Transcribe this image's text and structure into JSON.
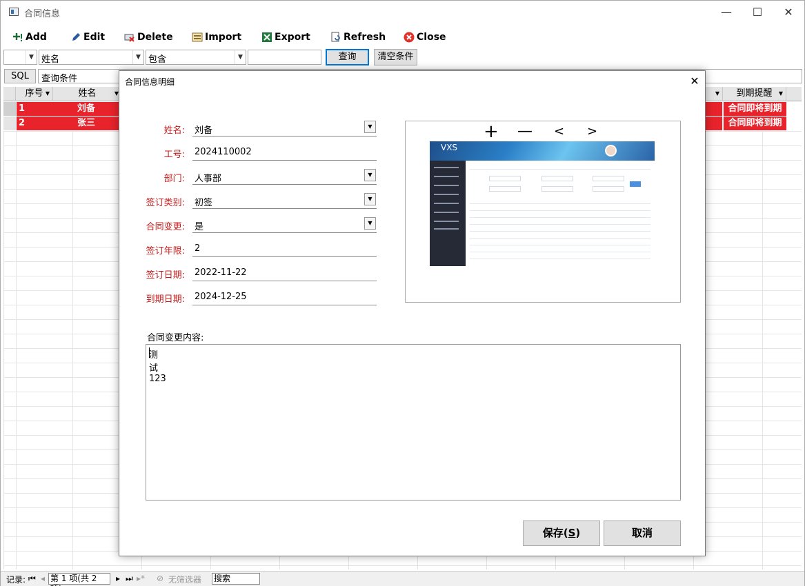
{
  "window": {
    "title": "合同信息",
    "controls": {
      "minimize": "—",
      "maximize": "☐",
      "close": "✕"
    }
  },
  "toolbar": {
    "add": "Add",
    "edit": "Edit",
    "delete": "Delete",
    "import": "Import",
    "export": "Export",
    "refresh": "Refresh",
    "close": "Close"
  },
  "filter": {
    "field1": "",
    "field2": "姓名",
    "operator": "包含",
    "value": "",
    "query_button": "查询",
    "clear_button": "清空条件"
  },
  "sql": {
    "label": "SQL",
    "text": "查询条件"
  },
  "grid": {
    "columns": [
      "序号",
      "姓名",
      "到期提醒"
    ],
    "rows": [
      {
        "index": "1",
        "name": "刘备",
        "reminder": "合同即将到期"
      },
      {
        "index": "2",
        "name": "张三",
        "reminder": "合同即将到期"
      }
    ]
  },
  "statusbar": {
    "records_label": "记录:",
    "page_text": "第 1 项(共 2 项)",
    "filter_label": "无筛选器",
    "search_text": "搜索"
  },
  "dialog": {
    "title": "合同信息明细",
    "close": "✕",
    "fields": [
      {
        "label": "姓名:",
        "value": "刘备",
        "dropdown": true
      },
      {
        "label": "工号:",
        "value": "2024110002",
        "dropdown": false
      },
      {
        "label": "部门:",
        "value": "人事部",
        "dropdown": true
      },
      {
        "label": "签订类别:",
        "value": "初签",
        "dropdown": true
      },
      {
        "label": "合同变更:",
        "value": "是",
        "dropdown": true
      },
      {
        "label": "签订年限:",
        "value": "2",
        "dropdown": false
      },
      {
        "label": "签订日期:",
        "value": "2022-11-22",
        "dropdown": false
      },
      {
        "label": "到期日期:",
        "value": "2024-12-25",
        "dropdown": false
      }
    ],
    "image_controls": {
      "zoom_in": "+",
      "zoom_out": "—",
      "prev": "<",
      "next": ">"
    },
    "preview_logo": "VXS",
    "content_label": "合同变更内容:",
    "content_text": "测试123",
    "save_button": "保存(",
    "save_key": "S",
    "save_suffix": ")",
    "cancel_button": "取消"
  }
}
